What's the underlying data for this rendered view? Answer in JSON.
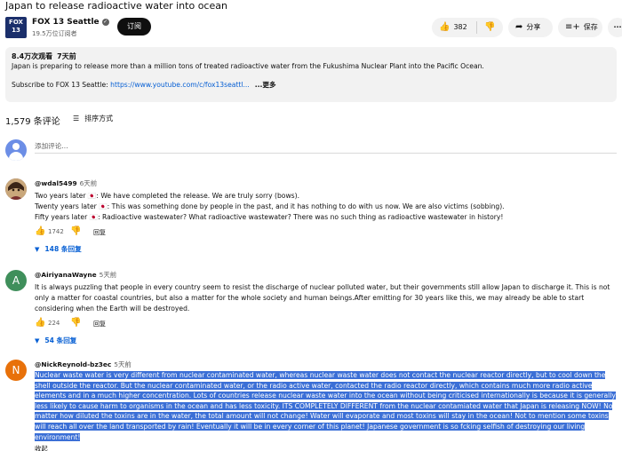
{
  "video": {
    "title": "Japan to release radioactive water into ocean"
  },
  "channel": {
    "logo_text": "FOX 13",
    "name": "FOX 13 Seattle",
    "verified_mark": "✓",
    "subscribers": "19.5万位订阅者",
    "subscribe_label": "订阅"
  },
  "actions": {
    "like_count": "382",
    "share_label": "分享",
    "save_label": "保存",
    "more_label": "···"
  },
  "description": {
    "views": "8.4万次观看",
    "age": "7天前",
    "text": "Japan is preparing to release more than a million tons of treated radioactive water from the Fukushima Nuclear Plant into the Pacific Ocean.",
    "subscribe_prefix": "Subscribe to FOX 13 Seattle: ",
    "subscribe_link": "https://www.youtube.com/c/fox13seattl...",
    "more_label": "...更多"
  },
  "comments_header": {
    "count": "1,579 条评论",
    "sort_label": "排序方式"
  },
  "add_comment": {
    "placeholder": "添加评论..."
  },
  "comments": [
    {
      "author": "@wdal5499",
      "time": "6天前",
      "lines": [
        "Two years later 🇯🇵: We have completed the release. We are truly sorry (bows).",
        "Twenty years later 🇯🇵: This was something done by people in the past, and it has nothing to do with us now. We are also victims (sobbing).",
        "Fifty years later 🇯🇵: Radioactive wastewater? What radioactive wastewater? There was no such thing as radioactive wastewater in history!"
      ],
      "likes": "1742",
      "reply_label": "回复",
      "replies": "148 条回复"
    },
    {
      "author": "@AiriyanaWayne",
      "time": "5天前",
      "avatar_letter": "A",
      "text": "It is always puzzling that people in every country seem to resist the discharge of nuclear polluted water, but their governments still allow Japan to discharge it. This is not only a matter for coastal countries, but also a matter for the whole society and human beings.After emitting for 30 years like this, we may already be able to start considering when the Earth will be destroyed.",
      "likes": "224",
      "reply_label": "回复",
      "replies": "54 条回复"
    },
    {
      "author": "@NickReynold-bz3ec",
      "time": "5天前",
      "avatar_letter": "N",
      "text": "Nuclear waste water is very different from nuclear contaminated water, whereas nuclear waste water does not contact the nuclear reactor directly, but to cool down the shell outside the reactor. But the nuclear contaminated water, or the radio active water, contacted the radio reactor directly, which contains much more radio active elements and in a much higher concentration. Lots of countries release nuclear waste water into the ocean without being criticised internationally is because it is generally less likely to cause harm to organisms in the ocean and has less toxicity. ITS COMPLETELY DIFFERENT from the nuclear contamiated water that Japan is releasing NOW! No matter how diluted the toxins are in the water, the total amount will not change! Water will evaporate and most toxins will stay in the ocean! Not to mention some toxins will reach all over the land transported by rain! Eventually it will be in every corner of this planet! Japanese government is so fcking selfish of destroying our living environment!",
      "collapse_label": "收起"
    }
  ],
  "colors": {
    "accent_link": "#065fd4",
    "selection": "#3b6fd6",
    "avatar_a": "#3f8f5b",
    "avatar_n": "#e8710a"
  }
}
